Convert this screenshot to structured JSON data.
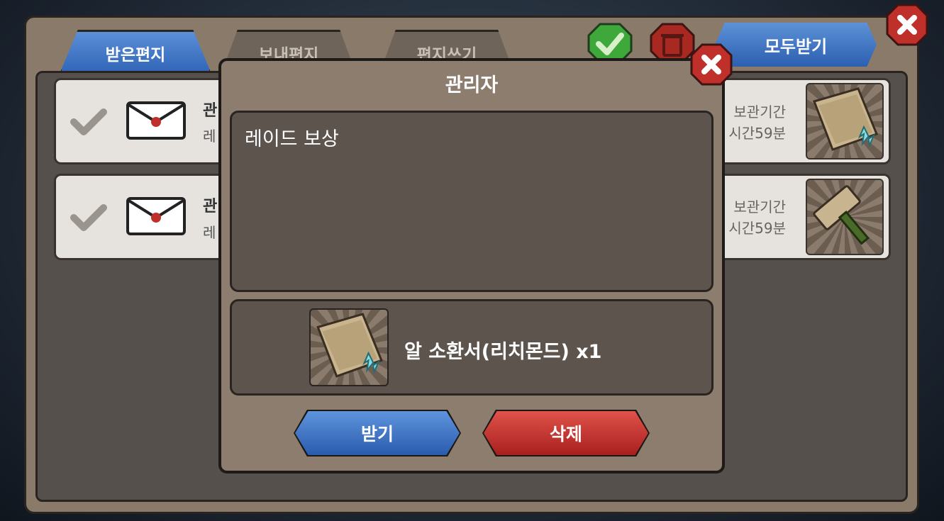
{
  "tabs": [
    {
      "label": "받은편지"
    },
    {
      "label": "보내편지"
    },
    {
      "label": "편지쓰기"
    }
  ],
  "header": {
    "receive_all_label": "모두받기"
  },
  "mail_list": [
    {
      "title": "관",
      "subtitle": "레",
      "keep_label": "보관기간",
      "remaining": "시간59분",
      "item_icon": "summon-scroll-icon"
    },
    {
      "title": "관",
      "subtitle": "레",
      "keep_label": "보관기간",
      "remaining": "시간59분",
      "item_icon": "hammer-icon"
    }
  ],
  "dialog": {
    "title": "관리자",
    "message": "레이드 보상",
    "reward": {
      "name": "알 소환서(리치몬드) x1",
      "icon": "summon-scroll-icon"
    },
    "accept_label": "받기",
    "delete_label": "삭제"
  },
  "colors": {
    "accent_blue": "#2f64b8",
    "danger_red": "#c0302a",
    "confirm_green": "#3fa83a"
  }
}
